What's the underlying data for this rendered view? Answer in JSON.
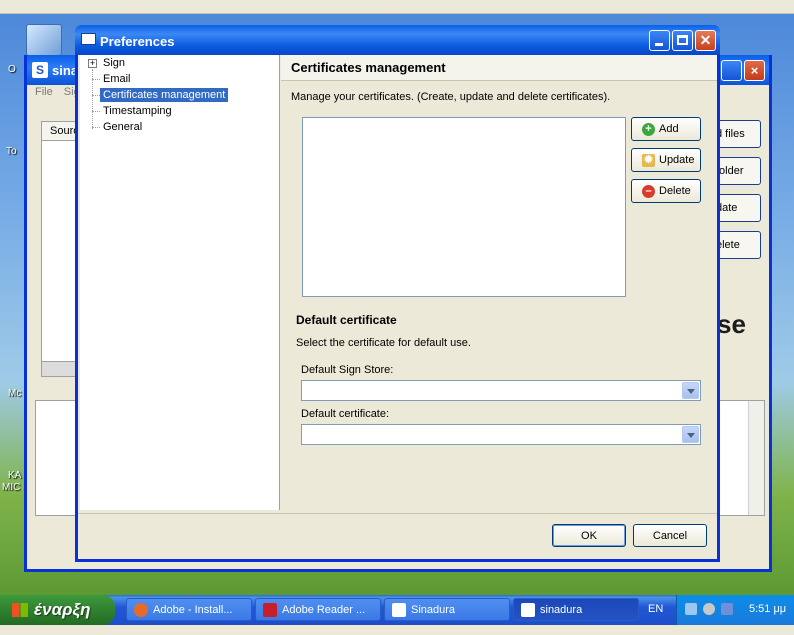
{
  "desktop": {
    "top_menu": "",
    "icon_labels": [
      "O",
      "To",
      "Mc",
      "KA",
      "MIC"
    ]
  },
  "bg_window": {
    "title": "sina",
    "menu": [
      "File",
      "Sig"
    ],
    "table_header": "Sourc",
    "side_buttons": [
      "d files",
      "folder",
      "date",
      "elete"
    ],
    "logo_text": "se"
  },
  "dialog": {
    "title": "Preferences",
    "tree": [
      {
        "label": "Sign",
        "expandable": true
      },
      {
        "label": "Email"
      },
      {
        "label": "Certificates management",
        "selected": true
      },
      {
        "label": "Timestamping"
      },
      {
        "label": "General"
      }
    ],
    "panel": {
      "heading": "Certificates management",
      "description": "Manage your certificates. (Create, update and delete certificates).",
      "buttons": {
        "add": "Add",
        "update": "Update",
        "delete": "Delete"
      },
      "section_title": "Default certificate",
      "section_desc": "Select the certificate for default use.",
      "store_label": "Default Sign Store:",
      "store_value": "",
      "cert_label": "Default certificate:",
      "cert_value": ""
    },
    "footer": {
      "ok": "OK",
      "cancel": "Cancel"
    }
  },
  "taskbar": {
    "start_label": "έναρξη",
    "tasks": [
      {
        "label": "Adobe - Install...",
        "icon": "firefox-icon",
        "color": "#e86a2a"
      },
      {
        "label": "Adobe Reader ...",
        "icon": "pdf-icon",
        "color": "#c8202a"
      },
      {
        "label": "Sinadura",
        "icon": "sinadura-icon",
        "color": "#ffffff"
      },
      {
        "label": "sinadura",
        "icon": "sinadura-icon",
        "color": "#ffffff",
        "active": true
      }
    ],
    "language": "EN",
    "clock": "5:51 μμ"
  }
}
